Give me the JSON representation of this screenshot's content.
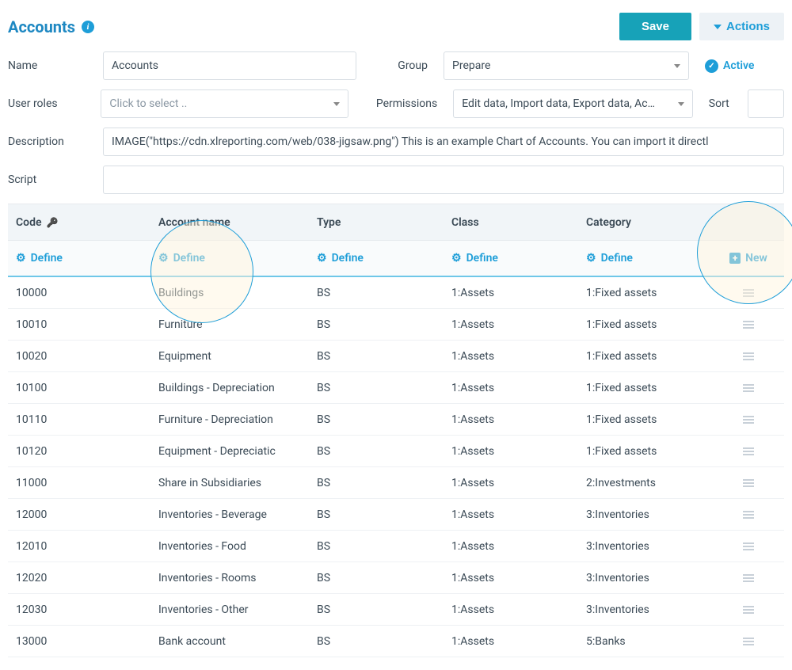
{
  "header": {
    "title": "Accounts",
    "save_label": "Save",
    "actions_label": "Actions"
  },
  "form": {
    "name_label": "Name",
    "name_value": "Accounts",
    "group_label": "Group",
    "group_value": "Prepare",
    "active_label": "Active",
    "roles_label": "User roles",
    "roles_placeholder": "Click to select ..",
    "perm_label": "Permissions",
    "perm_value": "Edit data, Import data, Export data, Ac…",
    "sort_label": "Sort",
    "desc_label": "Description",
    "desc_value": "IMAGE(\"https://cdn.xlreporting.com/web/038-jigsaw.png\") This is an example Chart of Accounts. You can import it directl",
    "script_label": "Script"
  },
  "table": {
    "headers": {
      "code": "Code",
      "name": "Account name",
      "type": "Type",
      "class": "Class",
      "category": "Category"
    },
    "define_label": "Define",
    "new_label": "New",
    "rows": [
      {
        "code": "10000",
        "name": "Buildings",
        "type": "BS",
        "class": "1:Assets",
        "category": "1:Fixed assets"
      },
      {
        "code": "10010",
        "name": "Furniture",
        "type": "BS",
        "class": "1:Assets",
        "category": "1:Fixed assets"
      },
      {
        "code": "10020",
        "name": "Equipment",
        "type": "BS",
        "class": "1:Assets",
        "category": "1:Fixed assets"
      },
      {
        "code": "10100",
        "name": "Buildings - Depreciation",
        "type": "BS",
        "class": "1:Assets",
        "category": "1:Fixed assets"
      },
      {
        "code": "10110",
        "name": "Furniture - Depreciation",
        "type": "BS",
        "class": "1:Assets",
        "category": "1:Fixed assets"
      },
      {
        "code": "10120",
        "name": "Equipment - Depreciatic",
        "type": "BS",
        "class": "1:Assets",
        "category": "1:Fixed assets"
      },
      {
        "code": "11000",
        "name": "Share in Subsidiaries",
        "type": "BS",
        "class": "1:Assets",
        "category": "2:Investments"
      },
      {
        "code": "12000",
        "name": "Inventories - Beverage",
        "type": "BS",
        "class": "1:Assets",
        "category": "3:Inventories"
      },
      {
        "code": "12010",
        "name": "Inventories - Food",
        "type": "BS",
        "class": "1:Assets",
        "category": "3:Inventories"
      },
      {
        "code": "12020",
        "name": "Inventories - Rooms",
        "type": "BS",
        "class": "1:Assets",
        "category": "3:Inventories"
      },
      {
        "code": "12030",
        "name": "Inventories - Other",
        "type": "BS",
        "class": "1:Assets",
        "category": "3:Inventories"
      },
      {
        "code": "13000",
        "name": "Bank account",
        "type": "BS",
        "class": "1:Assets",
        "category": "5:Banks"
      }
    ]
  }
}
